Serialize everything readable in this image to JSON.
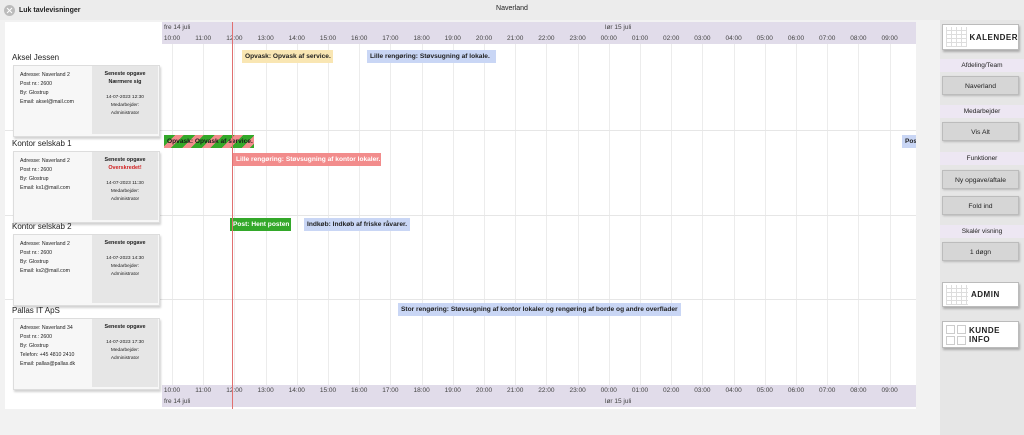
{
  "header": {
    "close_label": "Luk tavlevisninger",
    "title": "Naverland"
  },
  "timeline": {
    "day_labels": [
      "fre 14 juli",
      "lør 15 juli"
    ],
    "hours": [
      "10:00",
      "11:00",
      "12:00",
      "13:00",
      "14:00",
      "15:00",
      "16:00",
      "17:00",
      "18:00",
      "19:00",
      "20:00",
      "21:00",
      "22:00",
      "23:00",
      "00:00",
      "01:00",
      "02:00",
      "03:00",
      "04:00",
      "05:00",
      "06:00",
      "07:00",
      "08:00",
      "09:00"
    ]
  },
  "rows": [
    {
      "name": "Aksel Jessen",
      "info": [
        "Adresse: Naverland 2",
        "Post nr.: 2600",
        "By: Glostrup",
        "Email: aksel@mail.com"
      ],
      "task_title": "Seneste opgave",
      "task_status": "Nærmere sig",
      "task_date": "14-07-2023 12:30",
      "task_by": [
        "Medarbejder:",
        "Administrator"
      ]
    },
    {
      "name": "Kontor selskab 1",
      "info": [
        "Adresse: Naverland 2",
        "Post nr.: 2600",
        "By: Glostrup",
        "Email: ks1@mail.com"
      ],
      "task_title": "Seneste opgave",
      "task_status": "Overskredet!",
      "task_date": "14-07-2023 11:30",
      "task_by": [
        "Medarbejder:",
        "Administrator"
      ]
    },
    {
      "name": "Kontor selskab 2",
      "info": [
        "Adresse: Naverland 2",
        "Post nr.: 2600",
        "By: Glostrup",
        "Email: ks2@mail.com"
      ],
      "task_title": "Seneste opgave",
      "task_status": "",
      "task_date": "14-07-2023 14:30",
      "task_by": [
        "Medarbejder:",
        "Administrator"
      ]
    },
    {
      "name": "Pallas IT ApS",
      "info": [
        "Adresse: Naverland 34",
        "Post nr.: 2600",
        "By: Glostrup",
        "Telefon: +45 4810 2410",
        "Email: pallas@pallas.dk"
      ],
      "task_title": "Seneste opgave",
      "task_status": "",
      "task_date": "14-07-2023 17:30",
      "task_by": [
        "Medarbejder:",
        "Administrator"
      ]
    }
  ],
  "tasks": [
    {
      "row": 0,
      "label": "Opvask: Opvask af service.",
      "style": "yellow"
    },
    {
      "row": 0,
      "label": "Lille rengøring: Støvsugning af lokale.",
      "style": "blue"
    },
    {
      "row": 1,
      "label": "Opvask: Opvask af service.",
      "style": "striped"
    },
    {
      "row": 1,
      "label": "Lille rengøring: Støvsugning af kontor lokaler.",
      "style": "red"
    },
    {
      "row": 1,
      "label": "Post",
      "style": "blue"
    },
    {
      "row": 2,
      "label": "Post: Hent posten",
      "style": "green"
    },
    {
      "row": 2,
      "label": "Indkøb: Indkøb af friske råvarer.",
      "style": "blue"
    },
    {
      "row": 3,
      "label": "Stor rengøring: Støvsugning af kontor lokaler og rengøring af borde og andre overflader",
      "style": "blue"
    }
  ],
  "sidebar": {
    "calendar_label": "KALENDER",
    "department_heading": "Afdeling/Team",
    "department_value": "Naverland",
    "employee_heading": "Medarbejder",
    "employee_value": "Vis Alt",
    "functions_heading": "Funktioner",
    "new_task_label": "Ny opgave/aftale",
    "collapse_label": "Fold ind",
    "scale_heading": "Skalér visning",
    "scale_value": "1 døgn",
    "admin_label": "ADMIN",
    "customer_info_label": "KUNDE INFO"
  }
}
